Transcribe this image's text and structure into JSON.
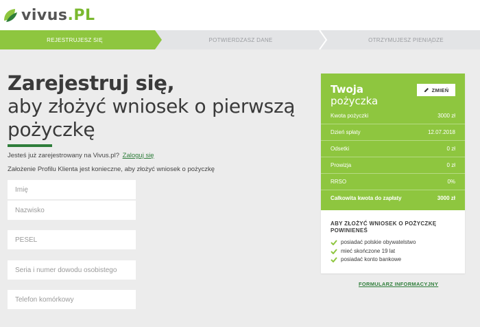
{
  "brand": {
    "name": "vivus",
    "tld": ".PL",
    "accent": "#8ec63f",
    "dark_green": "#2e7d3a"
  },
  "steps": [
    {
      "label": "REJESTRUJESZ SIĘ",
      "active": true
    },
    {
      "label": "POTWIERDZASZ DANE",
      "active": false
    },
    {
      "label": "OTRZYMUJESZ PIENIĄDZE",
      "active": false
    }
  ],
  "hero": {
    "title": "Zarejestruj się,",
    "subtitle_line1": "aby złożyć wniosek o pierwszą",
    "subtitle_line2": "pożyczkę"
  },
  "login": {
    "question": "Jesteś już zarejestrowany na Vivus.pl?",
    "link": "Zaloguj się"
  },
  "requirement_note": "Założenie Profilu Klienta jest konieczne, aby złożyć wniosek o pożyczkę",
  "form": {
    "first_name_placeholder": "Imię",
    "last_name_placeholder": "Nazwisko",
    "pesel_placeholder": "PESEL",
    "id_placeholder": "Seria i numer dowodu osobistego",
    "phone_placeholder": "Telefon komórkowy"
  },
  "loan_card": {
    "title": "Twoja",
    "subtitle": "pożyczka",
    "edit_label": "ZMIEŃ",
    "rows": [
      {
        "label": "Kwota pożyczki",
        "value": "3000 zł"
      },
      {
        "label": "Dzień spłaty",
        "value": "12.07.2018"
      },
      {
        "label": "Odsetki",
        "value": "0 zł"
      },
      {
        "label": "Prowizja",
        "value": "0 zł"
      },
      {
        "label": "RRSO",
        "value": "0%"
      }
    ],
    "total": {
      "label": "Całkowita kwota do zapłaty",
      "value": "3000 zł"
    },
    "requirements_title": "ABY ZŁOŻYĆ WNIOSEK O POŻYCZKĘ POWINIENEŚ",
    "requirements": [
      "posiadać polskie obywatelstwo",
      "mieć skończone 19 lat",
      "posiadać konto bankowe"
    ]
  },
  "info_form_link": "FORMULARZ INFORMACYJNY",
  "icons": {
    "logo": "vivus-leaf-logo",
    "edit": "pencil-icon",
    "check": "check-icon",
    "step": "chevron-right-icon"
  }
}
